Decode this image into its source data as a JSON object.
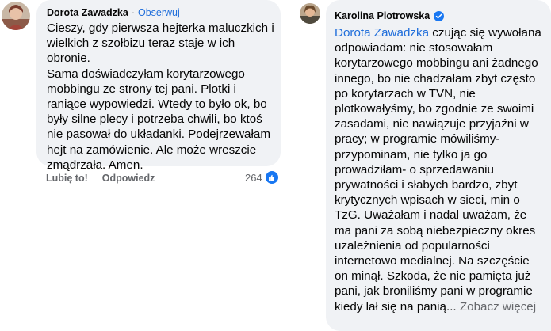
{
  "comment_left": {
    "author": "Dorota Zawadzka",
    "separator": "·",
    "follow_label": "Obserwuj",
    "paragraphs": [
      "Cieszy, gdy pierwsza hejterka maluczkich i wielkich z szołbizu teraz staje w ich obronie.",
      "Sama doświadczyłam korytarzowego mobbingu ze strony tej pani. Plotki i raniące wypowiedzi. Wtedy to było ok, bo były silne plecy i potrzeba chwili, bo ktoś nie pasował do układanki. Podejrzewałam hejt na zamówienie. Ale może wreszcie zmądrzała. Amen."
    ],
    "like_label": "Lubię to!",
    "reply_label": "Odpowiedz",
    "reaction_count": "264",
    "avatar_icon": "user-avatar-photo",
    "like_icon": "thumbs-up-icon"
  },
  "comment_right": {
    "author": "Karolina Piotrowska",
    "verified_icon": "verified-badge-icon",
    "mention": "Dorota Zawadzka",
    "text": " czując się wywołana odpowiadam: nie stosowałam korytarzowego mobbingu ani żadnego innego, bo nie chadzałam zbyt często po korytarzach w TVN, nie plotkowałyśmy, bo zgodnie ze swoimi zasadami, nie nawiązuje przyjaźni w pracy; w programie mówiliśmy- przypominam, nie tylko ja go prowadziłam- o sprzedawaniu prywatności i słabych bardzo, zbyt krytycznych wpisach w sieci, min o TzG. Uważałam i nadal uważam, że ma pani za sobą niebezpieczny okres uzależnienia od popularności internetowo medialnej. Na szczęście on minął. Szkoda, że nie pamięta już pani, jak broniliśmy pani w programie kiedy lał się na panią...",
    "see_more_label": "Zobacz więcej",
    "avatar_icon": "user-avatar-photo"
  },
  "colors": {
    "bubble": "#f0f2f5",
    "link": "#216fdb",
    "secondary_text": "#65676b",
    "like_badge": "#1877f2"
  }
}
